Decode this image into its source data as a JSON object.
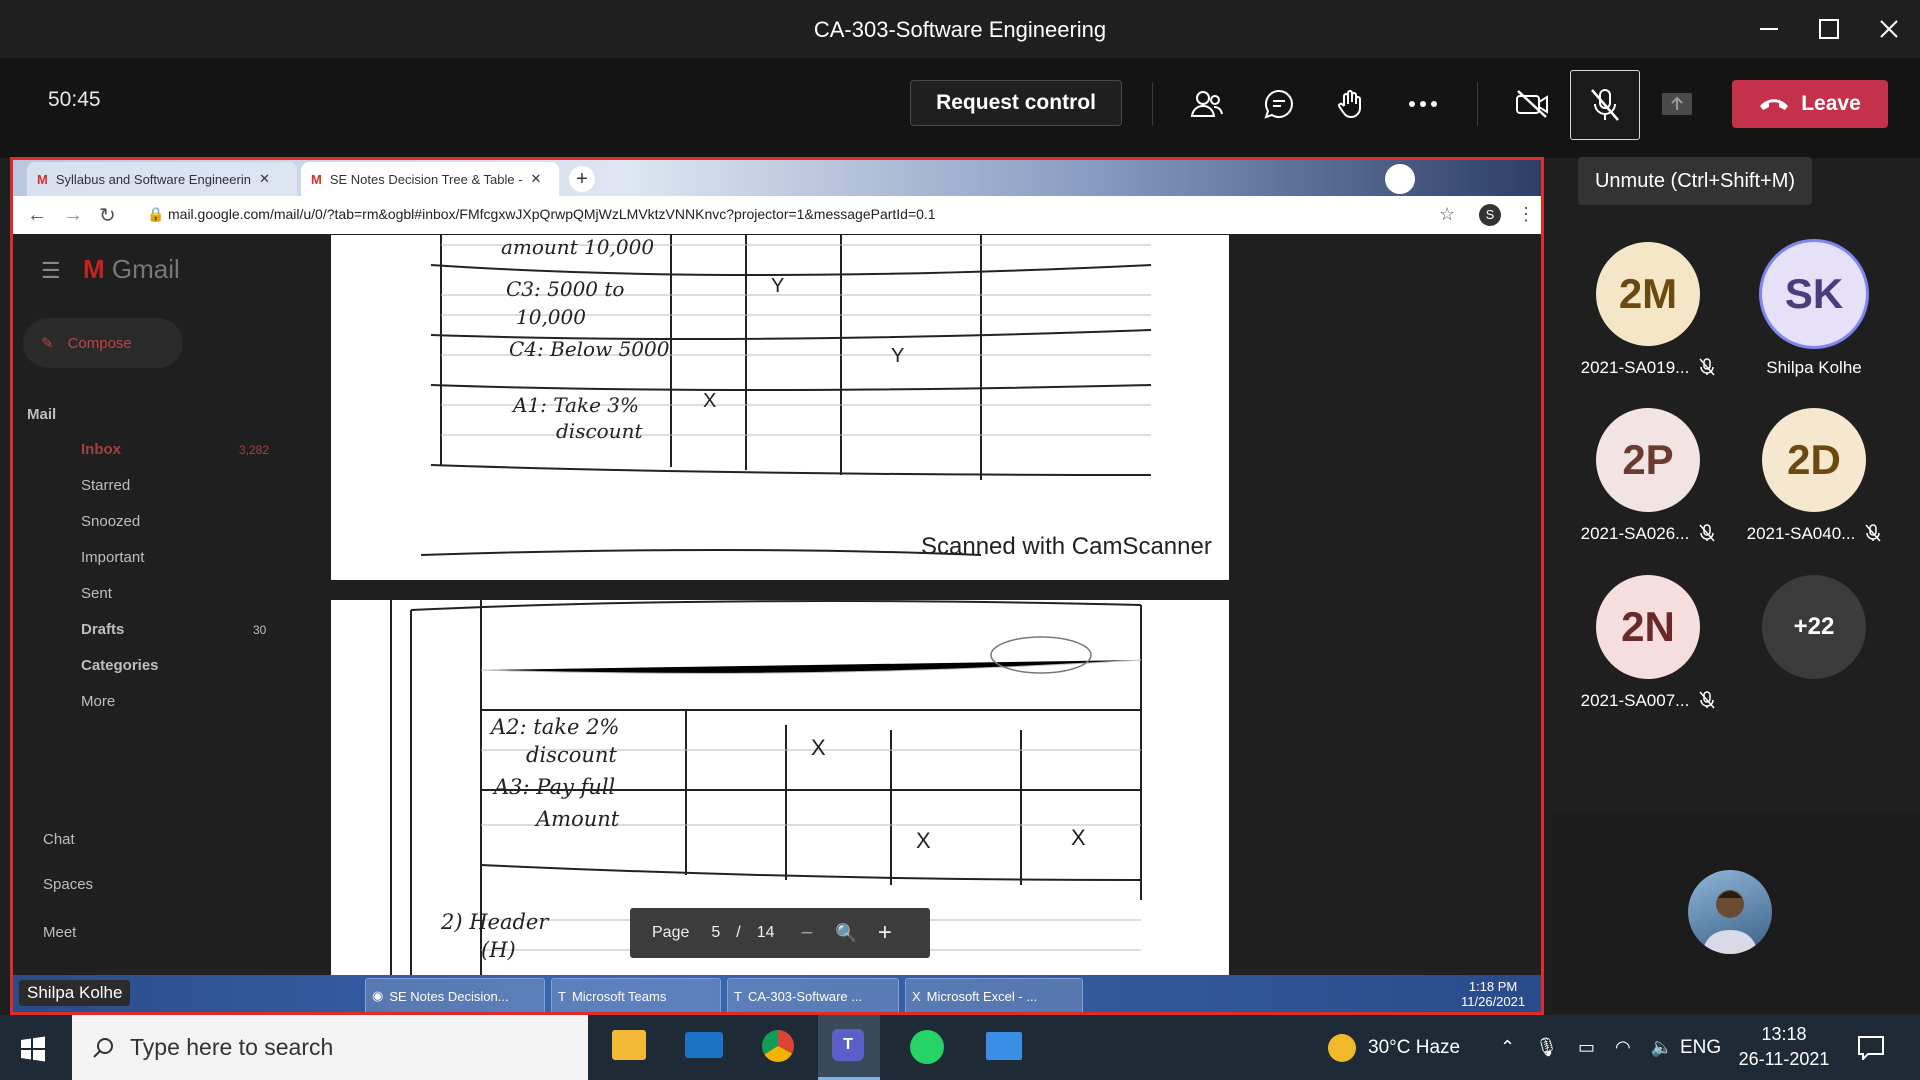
{
  "window": {
    "title": "CA-303-Software Engineering"
  },
  "meeting": {
    "timer": "50:45",
    "request_control_label": "Request control",
    "leave_label": "Leave",
    "mic_tooltip": "Unmute (Ctrl+Shift+M)",
    "leave_color": "#c4314b"
  },
  "participants": [
    {
      "initials": "2M",
      "name": "2021-SA019...",
      "muted": true,
      "bg": "#f5e6c8",
      "fg": "#6b4a12"
    },
    {
      "initials": "SK",
      "name": "Shilpa Kolhe",
      "muted": false,
      "bg": "#e6e0f8",
      "fg": "#4a3d7a"
    },
    {
      "initials": "2P",
      "name": "2021-SA026...",
      "muted": true,
      "bg": "#f1e4e2",
      "fg": "#6b3a30"
    },
    {
      "initials": "2D",
      "name": "2021-SA040...",
      "muted": true,
      "bg": "#f6e8cf",
      "fg": "#6b4a12"
    },
    {
      "initials": "2N",
      "name": "2021-SA007...",
      "muted": true,
      "bg": "#f7dede",
      "fg": "#6b2a2a"
    }
  ],
  "overflow_count": "+22",
  "shared": {
    "tabs": [
      {
        "label": "Syllabus and Software Engineerin",
        "active": false
      },
      {
        "label": "SE Notes Decision Tree & Table -",
        "active": true
      }
    ],
    "url": "mail.google.com/mail/u/0/?tab=rm&ogbl#inbox/FMfcgxwJXpQrwpQMjWzLMVktzVNNKnvc?projector=1&messagePartId=0.1",
    "gmail": {
      "logo": "Gmail",
      "compose": "Compose",
      "mail_header": "Mail",
      "items": [
        {
          "label": "Inbox",
          "count": "3,282"
        },
        {
          "label": "Starred",
          "count": ""
        },
        {
          "label": "Snoozed",
          "count": ""
        },
        {
          "label": "Important",
          "count": ""
        },
        {
          "label": "Sent",
          "count": ""
        },
        {
          "label": "Drafts",
          "count": "30"
        },
        {
          "label": "Categories",
          "count": ""
        },
        {
          "label": "More",
          "count": ""
        }
      ],
      "chat": "Chat",
      "spaces": "Spaces",
      "meet": "Meet"
    },
    "doc1": {
      "rows": [
        "amount 10,000",
        "C3: 5000 to",
        "10,000",
        "C4: Below 5000",
        "A1: Take 3%",
        "discount"
      ],
      "marks": [
        "Y",
        "Y",
        "X"
      ],
      "footer": "Scanned with CamScanner"
    },
    "doc2": {
      "rows": [
        "A2: take 2%",
        "discount",
        "A3: Pay full",
        "Amount",
        "2) Header",
        "(H)"
      ],
      "marks": [
        "X",
        "X",
        "X"
      ]
    },
    "pager": {
      "label": "Page",
      "current": "5",
      "sep": "/",
      "total": "14"
    },
    "presenter": "Shilpa Kolhe",
    "taskbar": [
      {
        "label": "SE Notes Decision..."
      },
      {
        "label": "Microsoft Teams"
      },
      {
        "label": "CA-303-Software ..."
      },
      {
        "label": "Microsoft Excel - ..."
      }
    ],
    "clock": {
      "time": "1:18 PM",
      "date": "11/26/2021"
    }
  },
  "os_taskbar": {
    "search_placeholder": "Type here to search",
    "weather": "30°C  Haze",
    "lang": "ENG",
    "time": "13:18",
    "date": "26-11-2021"
  }
}
